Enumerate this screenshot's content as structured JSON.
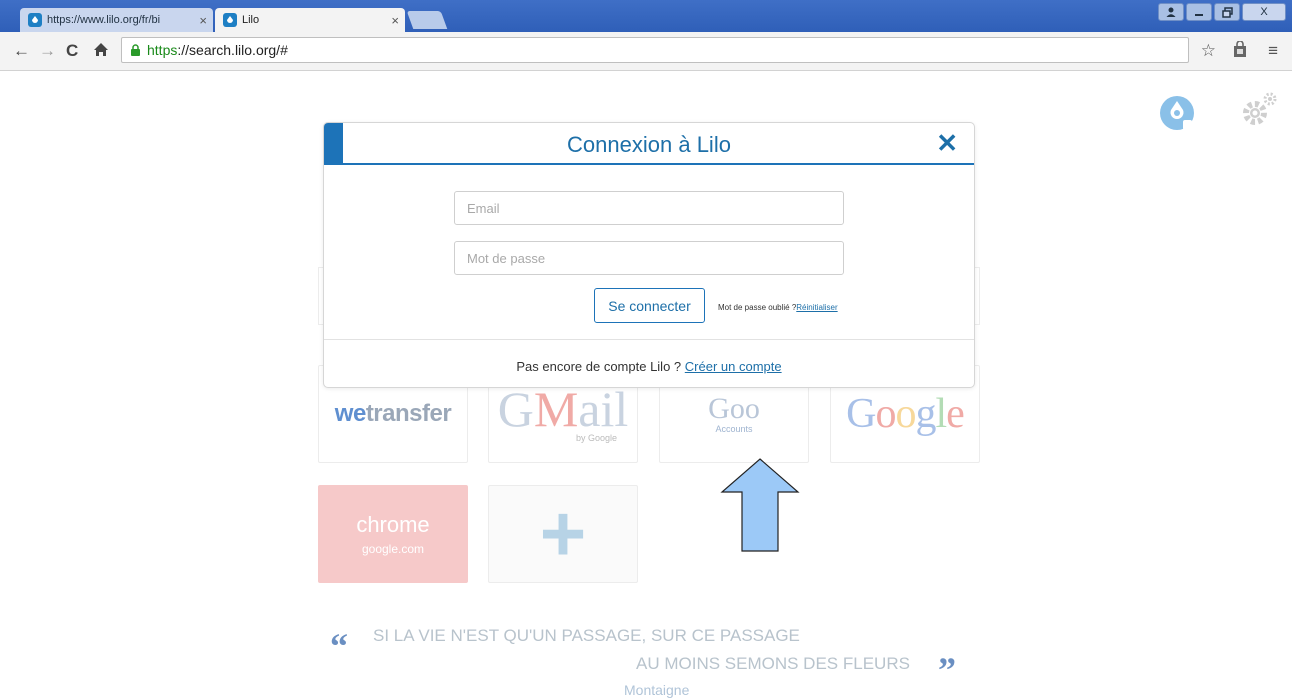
{
  "browser": {
    "tabs": [
      {
        "title": "https://www.lilo.org/fr/bi",
        "active": false
      },
      {
        "title": "Lilo",
        "active": true
      }
    ],
    "address": {
      "scheme": "https",
      "rest": "://search.lilo.org/#"
    },
    "window_buttons": {
      "close": "X"
    }
  },
  "login_modal": {
    "title": "Connexion à Lilo",
    "close_glyph": "✕",
    "email_placeholder": "Email",
    "password_placeholder": "Mot de passe",
    "login_button": "Se connecter",
    "forgot_text": "Mot de passe oublié ?",
    "reset_link": "Réinitialiser",
    "signup_text": "Pas encore de compte Lilo ?",
    "signup_link": "Créer un compte"
  },
  "tiles": {
    "wetransfer": {
      "we": "we",
      "rest": "transfer"
    },
    "gmail": {
      "g": "G",
      "m": "M",
      "rest": "ail",
      "sub": "by Google"
    },
    "google_accounts": {
      "text": "Goo",
      "sub": "Accounts"
    },
    "google": {
      "letters": [
        "G",
        "o",
        "o",
        "g",
        "l",
        "e"
      ],
      "colors": [
        "#a8c0e8",
        "#f0aaa6",
        "#f7d89a",
        "#a8c0e8",
        "#b3dcb5",
        "#f0aaa6"
      ]
    },
    "chrome": {
      "label": "chrome",
      "sub": "google.com"
    },
    "add": {
      "glyph": "+"
    }
  },
  "quote": {
    "line1": "SI LA VIE N'EST QU'UN PASSAGE, SUR CE PASSAGE",
    "line2": "AU MOINS SEMONS DES FLEURS",
    "author": "Montaigne"
  },
  "colors": {
    "accent": "#1d73b8",
    "arrow_fill": "#9cc9f7"
  }
}
